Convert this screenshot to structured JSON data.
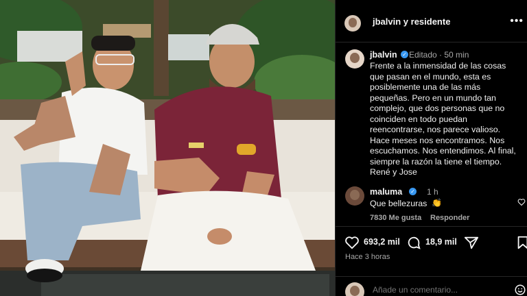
{
  "post": {
    "header": {
      "accounts": "jbalvin y residente",
      "more_icon": "more-horizontal-icon"
    },
    "caption": {
      "username": "jbalvin",
      "meta": "Editado · 50 min",
      "text": "Frente a la inmensidad de las cosas que pasan en el mundo, esta es posiblemente una de las más pequeñas. Pero en un mundo tan complejo, que dos personas que no coinciden en todo puedan reencontrarse, nos parece valioso. Hace meses nos encontramos. Nos escuchamos. Nos entendimos. Al final, siempre la razón la tiene el tiempo.",
      "signature": "René y Jose"
    },
    "comment": {
      "username": "maluma",
      "time": "1 h",
      "text": "Que bellezuras",
      "emoji": "👏",
      "likes": "7830 Me gusta",
      "reply": "Responder"
    },
    "actions": {
      "likes": "693,2 mil",
      "comments": "18,9 mil",
      "posted": "Hace 3 horas"
    },
    "add_comment": {
      "placeholder": "Añade un comentario..."
    }
  },
  "colors": {
    "verified": "#3897f0",
    "background": "#000000",
    "muted": "#a8a8a8"
  }
}
